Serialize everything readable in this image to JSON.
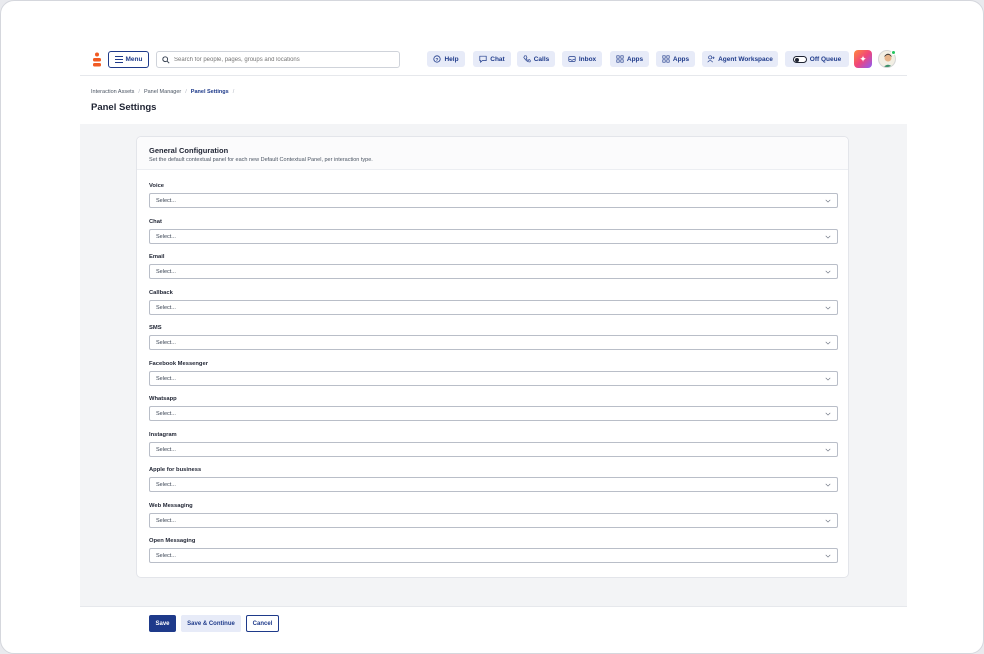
{
  "topbar": {
    "menu_label": "Menu",
    "search_placeholder": "Search for people, pages, groups and locations",
    "buttons": {
      "help": "Help",
      "chat": "Chat",
      "calls": "Calls",
      "inbox": "Inbox",
      "apps1": "Apps",
      "apps2": "Apps",
      "agent_workspace": "Agent Workspace",
      "off_queue": "Off Queue"
    },
    "accent_color": "#1e3a8a"
  },
  "breadcrumb": [
    "Interaction Assets",
    "Panel Manager",
    "Panel Settings"
  ],
  "page_title": "Panel Settings",
  "card": {
    "title": "General Configuration",
    "description": "Set the default contextual panel for each new Default Contextual Panel, per interaction type.",
    "fields": [
      {
        "label": "Voice",
        "value": "Select..."
      },
      {
        "label": "Chat",
        "value": "Select..."
      },
      {
        "label": "Email",
        "value": "Select..."
      },
      {
        "label": "Callback",
        "value": "Select..."
      },
      {
        "label": "SMS",
        "value": "Select..."
      },
      {
        "label": "Facebook Messenger",
        "value": "Select..."
      },
      {
        "label": "Whatsapp",
        "value": "Select..."
      },
      {
        "label": "Instagram",
        "value": "Select..."
      },
      {
        "label": "Apple for business",
        "value": "Select..."
      },
      {
        "label": "Web Messaging",
        "value": "Select..."
      },
      {
        "label": "Open Messaging",
        "value": "Select..."
      }
    ]
  },
  "footer": {
    "save": "Save",
    "save_continue": "Save & Continue",
    "cancel": "Cancel"
  }
}
